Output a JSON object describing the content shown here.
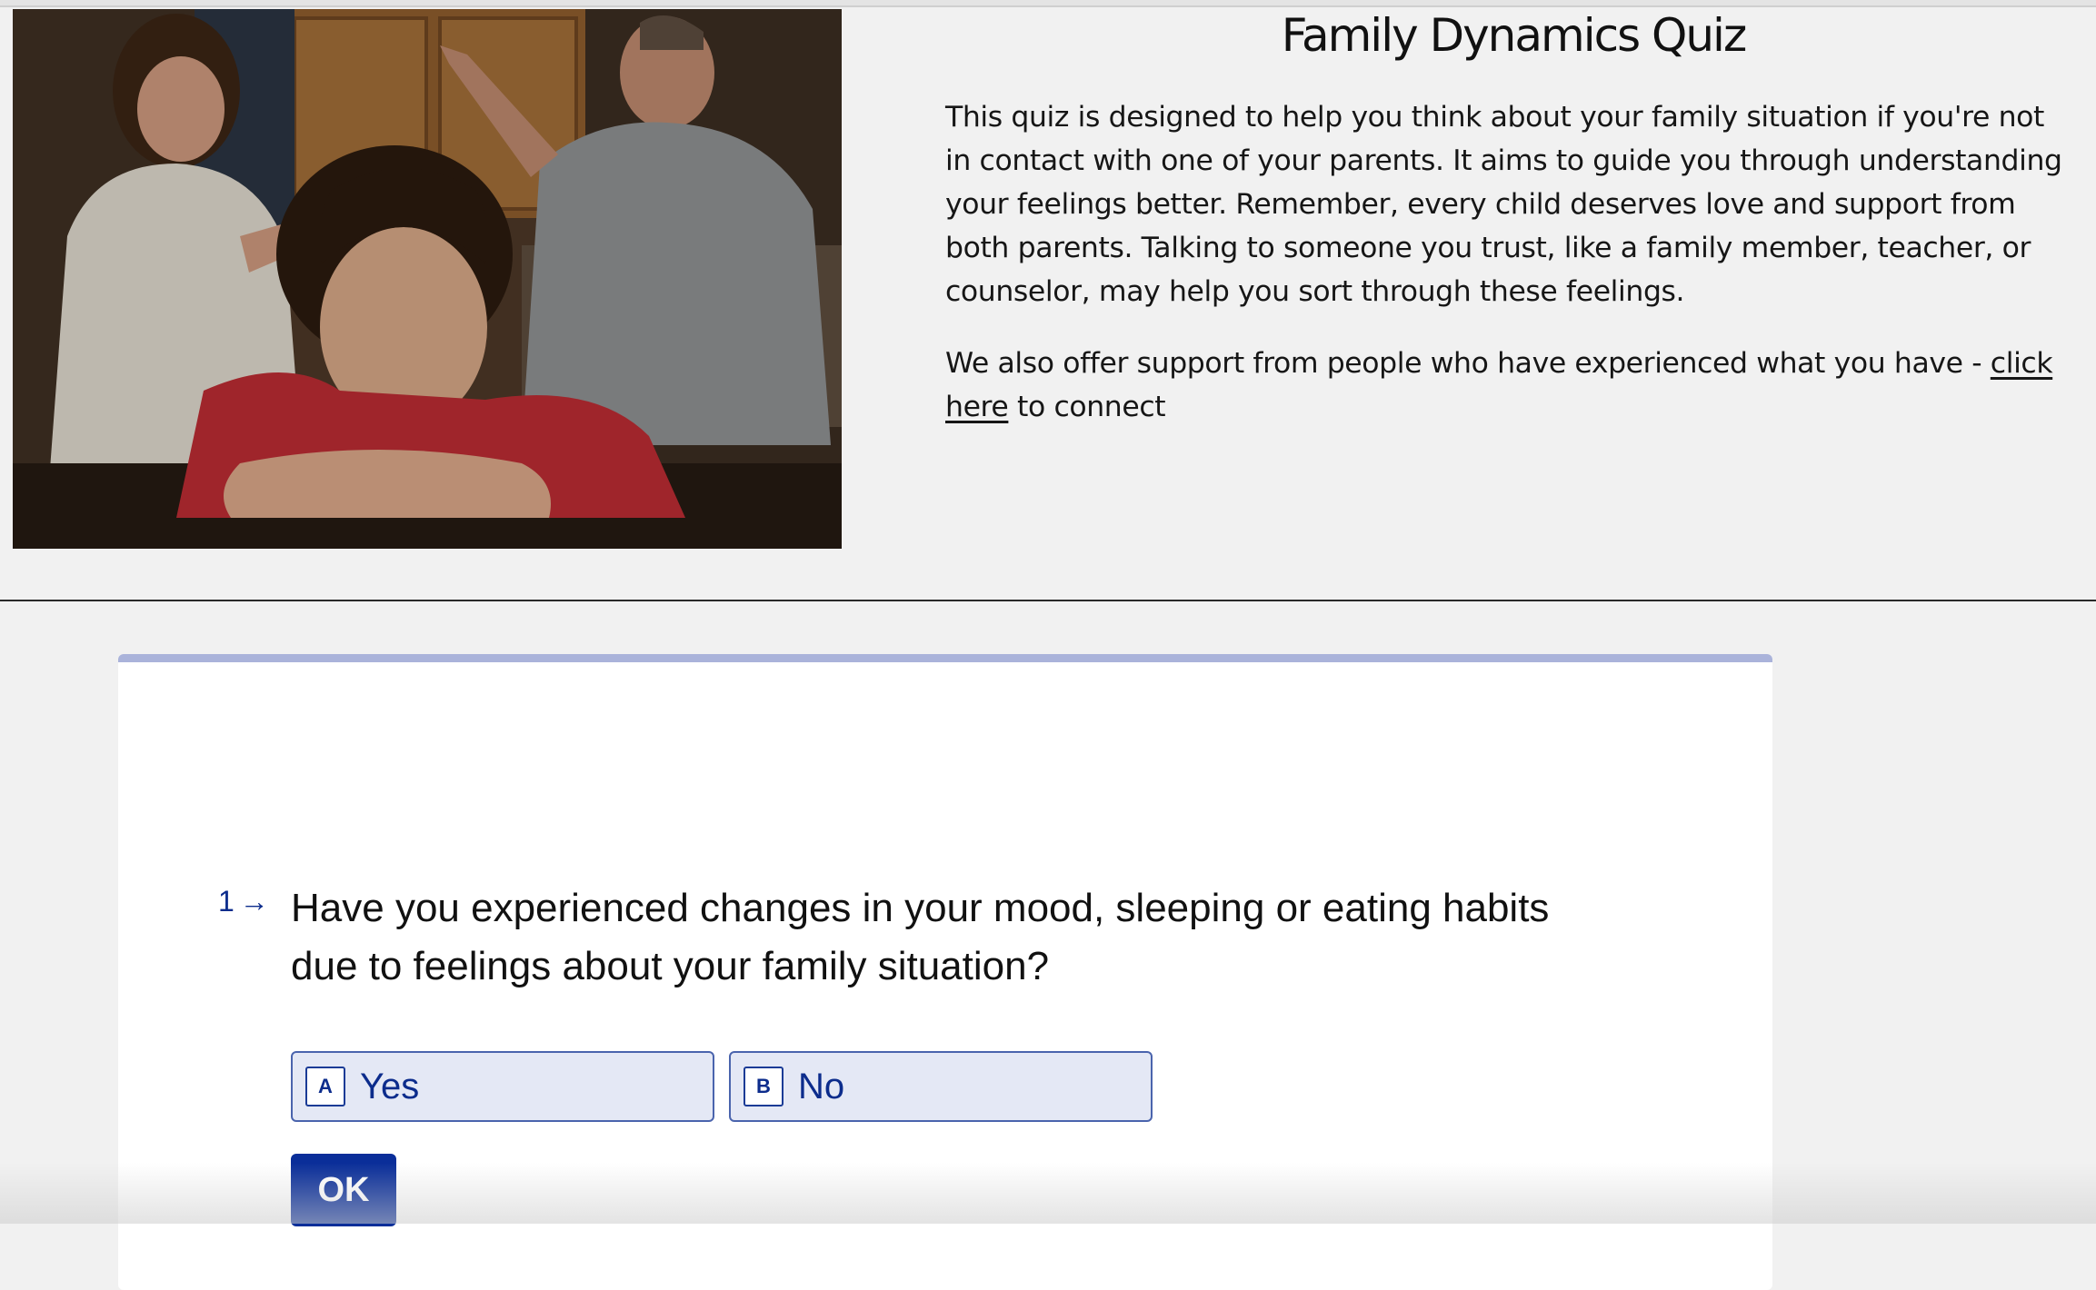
{
  "hero": {
    "image_alt": "A teenage boy rests his head on his arms at a table while two adults argue in the kitchen behind him",
    "title": "Family Dynamics Quiz",
    "paragraph1": "This quiz is designed to help you think about your family situation if you're not in contact with one of your parents. It aims to guide you through understanding your feelings better. Remember, every child deserves love and support from both parents. Talking to someone you trust, like a family member, teacher, or counselor, may help you sort through these feelings.",
    "paragraph2_before": "We also offer support from people who have experienced what you have -",
    "link_text": "click here",
    "paragraph2_after": " to connect"
  },
  "quiz": {
    "question_number": "1",
    "question_text": "Have you experienced changes in your mood, sleeping or eating habits due to feelings about your family situation?",
    "choices": [
      {
        "key": "A",
        "label": "Yes"
      },
      {
        "key": "B",
        "label": "No"
      }
    ],
    "ok_label": "OK",
    "progress": 0
  },
  "colors": {
    "accent": "#0a2e99",
    "choice_bg": "#e4e8f5",
    "progress_track": "#aab3da",
    "page_bg": "#f1f1f1"
  }
}
